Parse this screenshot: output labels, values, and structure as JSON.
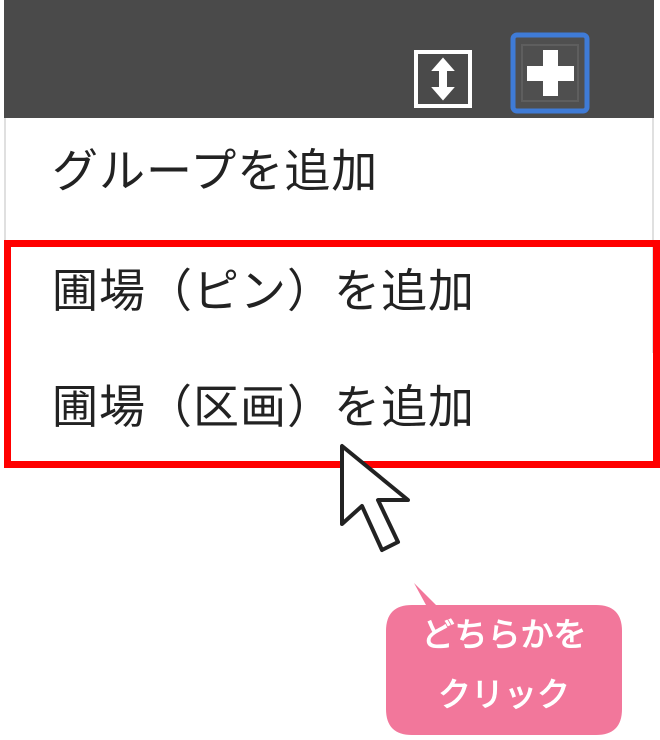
{
  "toolbar": {
    "expand_icon": "expand-vertical-icon",
    "add_icon": "plus-icon"
  },
  "menu": {
    "items": [
      {
        "label": "グループを追加"
      },
      {
        "label": "圃場（ピン）を追加"
      },
      {
        "label": "圃場（区画）を追加"
      }
    ]
  },
  "callout": {
    "lines": [
      "どちらかを",
      "クリック"
    ]
  },
  "colors": {
    "toolbar": "#4a4a4a",
    "highlight": "#ff0000",
    "callout": "#f2779b",
    "focus": "#3f7bd6"
  }
}
